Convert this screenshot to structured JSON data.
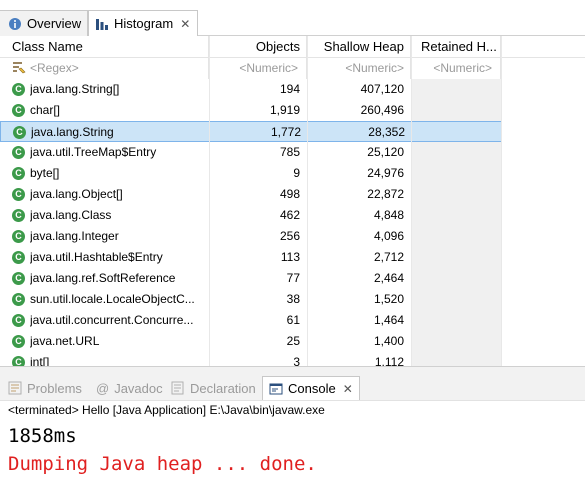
{
  "tabs": {
    "overview": "Overview",
    "histogram": "Histogram",
    "close_glyph": "✕"
  },
  "columns": {
    "class_name": "Class Name",
    "objects": "Objects",
    "shallow_heap": "Shallow Heap",
    "retained_heap": "Retained H..."
  },
  "filters": {
    "class_name": "<Regex>",
    "objects": "<Numeric>",
    "shallow_heap": "<Numeric>",
    "retained_heap": "<Numeric>"
  },
  "rows": [
    {
      "name": "java.lang.String[]",
      "objects": "194",
      "shallow": "407,120"
    },
    {
      "name": "char[]",
      "objects": "1,919",
      "shallow": "260,496"
    },
    {
      "name": "java.lang.String",
      "objects": "1,772",
      "shallow": "28,352",
      "selected": true
    },
    {
      "name": "java.util.TreeMap$Entry",
      "objects": "785",
      "shallow": "25,120"
    },
    {
      "name": "byte[]",
      "objects": "9",
      "shallow": "24,976"
    },
    {
      "name": "java.lang.Object[]",
      "objects": "498",
      "shallow": "22,872"
    },
    {
      "name": "java.lang.Class",
      "objects": "462",
      "shallow": "4,848"
    },
    {
      "name": "java.lang.Integer",
      "objects": "256",
      "shallow": "4,096"
    },
    {
      "name": "java.util.Hashtable$Entry",
      "objects": "113",
      "shallow": "2,712"
    },
    {
      "name": "java.lang.ref.SoftReference",
      "objects": "77",
      "shallow": "2,464"
    },
    {
      "name": "sun.util.locale.LocaleObjectC...",
      "objects": "38",
      "shallow": "1,520"
    },
    {
      "name": "java.util.concurrent.Concurre...",
      "objects": "61",
      "shallow": "1,464"
    },
    {
      "name": "java.net.URL",
      "objects": "25",
      "shallow": "1,400"
    },
    {
      "name": "int[]",
      "objects": "3",
      "shallow": "1,112"
    }
  ],
  "console_tabs": {
    "problems": "Problems",
    "javadoc": "Javadoc",
    "declaration": "Declaration",
    "console": "Console"
  },
  "console": {
    "status": "<terminated> Hello [Java Application] E:\\Java\\bin\\javaw.exe",
    "line1": "1858ms",
    "line2": "Dumping Java heap ... done."
  },
  "colors": {
    "class_icon": "#3c9a4a",
    "selection": "#cce4f7",
    "error_text": "#e02020"
  }
}
